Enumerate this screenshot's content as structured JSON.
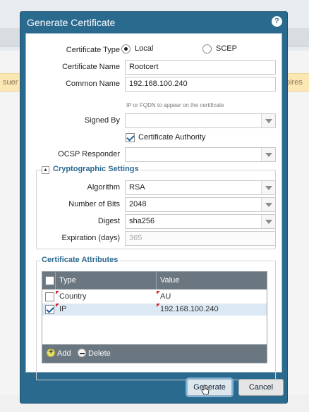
{
  "background": {
    "left_text": "suer",
    "right_text": "pires"
  },
  "dialog": {
    "title": "Generate Certificate",
    "help_icon": "question-circle-icon",
    "fields": {
      "certificate_type_label": "Certificate Type",
      "type_local": "Local",
      "type_scep": "SCEP",
      "certificate_name_label": "Certificate Name",
      "certificate_name_value": "Rootcert",
      "common_name_label": "Common Name",
      "common_name_value": "192.168.100.240",
      "common_name_hint": "IP or FQDN to appear on the certificate",
      "signed_by_label": "Signed By",
      "signed_by_value": "",
      "certificate_authority_label": "Certificate Authority",
      "ocsp_responder_label": "OCSP Responder",
      "ocsp_responder_value": ""
    },
    "crypto": {
      "legend": "Cryptographic Settings",
      "algorithm_label": "Algorithm",
      "algorithm_value": "RSA",
      "bits_label": "Number of Bits",
      "bits_value": "2048",
      "digest_label": "Digest",
      "digest_value": "sha256",
      "expiration_label": "Expiration (days)",
      "expiration_value": "365"
    },
    "attributes": {
      "legend": "Certificate Attributes",
      "col_type": "Type",
      "col_value": "Value",
      "rows": [
        {
          "type": "Country",
          "value": "AU",
          "checked": false
        },
        {
          "type": "IP",
          "value": "192.168.100.240",
          "checked": true
        }
      ],
      "add_label": "Add",
      "delete_label": "Delete"
    },
    "buttons": {
      "generate": "Generate",
      "cancel": "Cancel"
    }
  },
  "colors": {
    "accent": "#2b6a8f",
    "table_header": "#6b7780",
    "warning_strip": "#fbe7b3"
  }
}
